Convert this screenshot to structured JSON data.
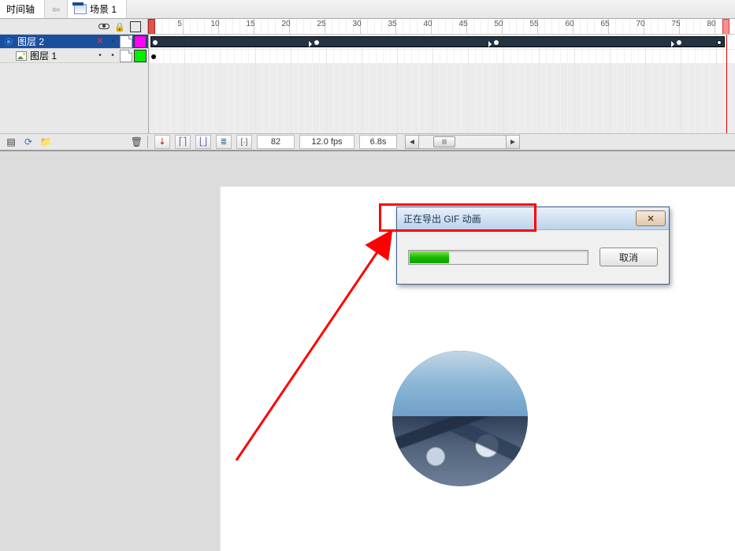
{
  "tabs": {
    "timeline_tab": "时间轴",
    "scene_label": "场景 1"
  },
  "ruler": {
    "first": 1,
    "step": 5,
    "last": 80,
    "count": 82
  },
  "layers": [
    {
      "name": "图层 2",
      "type": "guide",
      "selected": true,
      "x_mark": true,
      "swatch": "magenta"
    },
    {
      "name": "图层 1",
      "type": "image",
      "selected": false,
      "x_mark": false,
      "swatch": "green"
    }
  ],
  "status": {
    "frame": "82",
    "fps": "12.0 fps",
    "time": "6.8s"
  },
  "dialog": {
    "title": "正在导出 GIF 动画",
    "cancel": "取消",
    "progress_pct": 22,
    "close_glyph": "✕"
  },
  "icons": {
    "arrow_left": "◄",
    "arrow_right": "►",
    "thumb_grip": "lll",
    "onion1": "⎡⎤",
    "onion2": "⎣⎦",
    "multi": "≣",
    "center": "[·]"
  }
}
